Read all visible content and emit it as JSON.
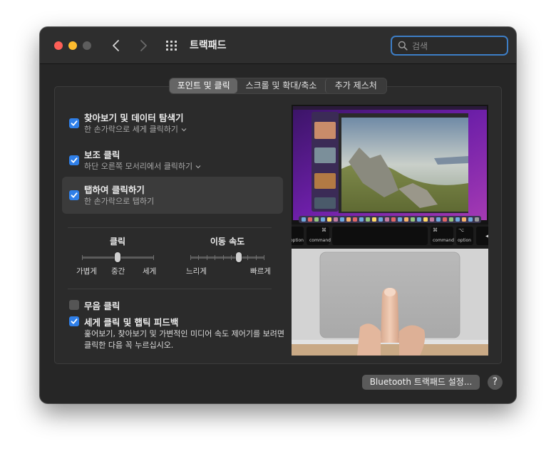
{
  "window": {
    "title": "트랙패드"
  },
  "search": {
    "placeholder": "검색"
  },
  "tabs": [
    {
      "label": "포인트 및 클릭",
      "selected": true
    },
    {
      "label": "스크롤 및 확대/축소",
      "selected": false
    },
    {
      "label": "추가 제스처",
      "selected": false
    }
  ],
  "options": [
    {
      "title": "찾아보기 및 데이터 탐색기",
      "subtitle": "한 손가락으로 세게 클릭하기",
      "checked": true,
      "has_menu": true
    },
    {
      "title": "보조 클릭",
      "subtitle": "하단 오른쪽 모서리에서 클릭하기",
      "checked": true,
      "has_menu": true
    },
    {
      "title": "탭하여 클릭하기",
      "subtitle": "한 손가락으로 탭하기",
      "checked": true,
      "selected": true,
      "has_menu": false
    }
  ],
  "sliders": {
    "click": {
      "title": "클릭",
      "labels": [
        "가볍게",
        "중간",
        "세게"
      ],
      "value": 0.5
    },
    "tracking": {
      "title": "이동 속도",
      "labels": [
        "느리게",
        "빠르게"
      ],
      "value": 0.7
    }
  },
  "silent_click": {
    "label": "무음 클릭",
    "checked": false
  },
  "force_click": {
    "label": "세게 클릭 및 햅틱 피드백",
    "checked": true,
    "description_lines": [
      "훑어보기, 찾아보기 및 가변적인 미디어 속도 제어기를 보려면",
      "클릭한 다음 꼭 누르십시오."
    ]
  },
  "preview": {
    "keys": [
      "option",
      "command",
      "command",
      "option"
    ],
    "key_symbols": [
      "⌥",
      "⌘",
      "⌘",
      "⌥"
    ]
  },
  "footer": {
    "bluetooth_button": "Bluetooth 트랙패드 설정...",
    "help": "?"
  },
  "colors": {
    "accent": "#2f7fe8",
    "window_bg": "#262626",
    "close": "#fe5f57",
    "minimize": "#febc2e"
  }
}
